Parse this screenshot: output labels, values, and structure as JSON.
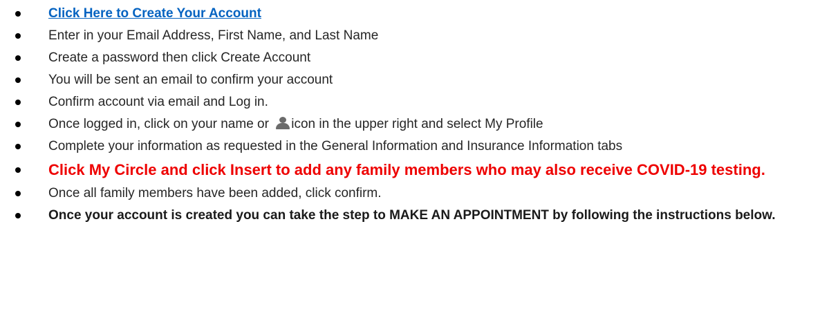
{
  "steps": {
    "create_link": "Click Here to Create Your Account",
    "enter_info": "Enter in your Email Address, First Name, and Last Name",
    "create_password": "Create a password then click Create Account",
    "confirm_email": "You will be sent an email to confirm your account",
    "confirm_login": "Confirm account via email and Log in.",
    "profile_prefix": "Once logged in, click on your name or",
    "profile_icon": "user-icon",
    "profile_suffix": "icon in the upper right and select My Profile",
    "complete_info": "Complete your information as requested in the General Information and Insurance Information tabs",
    "my_circle": "Click My Circle and click Insert to add any family members who may also receive COVID-19 testing.",
    "confirm_family": "Once all family members have been added, click confirm.",
    "make_appointment": "Once your account is created you can take the step to MAKE AN APPOINTMENT by following the instructions below."
  },
  "colors": {
    "link": "#0563c1",
    "highlight": "#ee0000",
    "text": "#262626"
  }
}
